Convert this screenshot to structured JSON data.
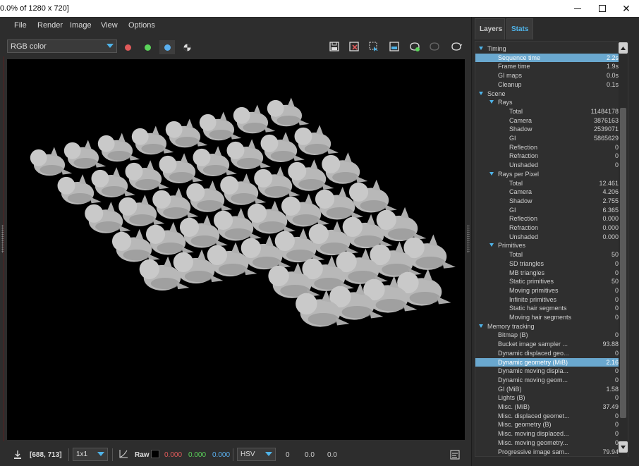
{
  "window": {
    "title": "0.0% of 1280 x 720]"
  },
  "menu": [
    "File",
    "Render",
    "Image",
    "View",
    "Options"
  ],
  "toolbar": {
    "channel_select": "RGB color",
    "channel_colors": [
      "#e05a5a",
      "#5ad35a",
      "#5ab0f0"
    ]
  },
  "tabs": [
    "Layers",
    "Stats"
  ],
  "stats": [
    {
      "label": "Timing",
      "value": "",
      "level": 0,
      "group": true
    },
    {
      "label": "Sequence time",
      "value": "2.2s",
      "level": 1,
      "highlight": true
    },
    {
      "label": "Frame time",
      "value": "1.9s",
      "level": 1
    },
    {
      "label": "GI maps",
      "value": "0.0s",
      "level": 1
    },
    {
      "label": "Cleanup",
      "value": "0.1s",
      "level": 1
    },
    {
      "label": "Scene",
      "value": "",
      "level": 0,
      "group": true
    },
    {
      "label": "Rays",
      "value": "",
      "level": 1,
      "group": true
    },
    {
      "label": "Total",
      "value": "11484178",
      "level": 2
    },
    {
      "label": "Camera",
      "value": "3876163",
      "level": 2
    },
    {
      "label": "Shadow",
      "value": "2539071",
      "level": 2
    },
    {
      "label": "GI",
      "value": "5865629",
      "level": 2
    },
    {
      "label": "Reflection",
      "value": "0",
      "level": 2
    },
    {
      "label": "Refraction",
      "value": "0",
      "level": 2
    },
    {
      "label": "Unshaded",
      "value": "0",
      "level": 2
    },
    {
      "label": "Rays per Pixel",
      "value": "",
      "level": 1,
      "group": true
    },
    {
      "label": "Total",
      "value": "12.461",
      "level": 2
    },
    {
      "label": "Camera",
      "value": "4.206",
      "level": 2
    },
    {
      "label": "Shadow",
      "value": "2.755",
      "level": 2
    },
    {
      "label": "GI",
      "value": "6.365",
      "level": 2
    },
    {
      "label": "Reflection",
      "value": "0.000",
      "level": 2
    },
    {
      "label": "Refraction",
      "value": "0.000",
      "level": 2
    },
    {
      "label": "Unshaded",
      "value": "0.000",
      "level": 2
    },
    {
      "label": "Primitives",
      "value": "",
      "level": 1,
      "group": true
    },
    {
      "label": "Total",
      "value": "50",
      "level": 2
    },
    {
      "label": "SD triangles",
      "value": "0",
      "level": 2
    },
    {
      "label": "MB triangles",
      "value": "0",
      "level": 2
    },
    {
      "label": "Static primitives",
      "value": "50",
      "level": 2
    },
    {
      "label": "Moving primitives",
      "value": "0",
      "level": 2
    },
    {
      "label": "Infinite primitives",
      "value": "0",
      "level": 2
    },
    {
      "label": "Static hair segments",
      "value": "0",
      "level": 2
    },
    {
      "label": "Moving hair segments",
      "value": "0",
      "level": 2
    },
    {
      "label": "Memory tracking",
      "value": "",
      "level": 0,
      "group": true
    },
    {
      "label": "Bitmap (B)",
      "value": "0",
      "level": 1
    },
    {
      "label": "Bucket image sampler ...",
      "value": "93.88",
      "level": 1
    },
    {
      "label": "Dynamic displaced geo...",
      "value": "0",
      "level": 1
    },
    {
      "label": "Dynamic geometry (MiB)",
      "value": "2.16",
      "level": 1,
      "highlight": true
    },
    {
      "label": "Dynamic moving displa...",
      "value": "0",
      "level": 1
    },
    {
      "label": "Dynamic moving geom...",
      "value": "0",
      "level": 1
    },
    {
      "label": "GI (MiB)",
      "value": "1.58",
      "level": 1
    },
    {
      "label": "Lights (B)",
      "value": "0",
      "level": 1
    },
    {
      "label": "Misc. (MiB)",
      "value": "37.49",
      "level": 1
    },
    {
      "label": "Misc. displaced geomet...",
      "value": "0",
      "level": 1
    },
    {
      "label": "Misc. geometry (B)",
      "value": "0",
      "level": 1
    },
    {
      "label": "Misc. moving displaced...",
      "value": "0",
      "level": 1
    },
    {
      "label": "Misc. moving geometry...",
      "value": "0",
      "level": 1
    },
    {
      "label": "Progressive image sam...",
      "value": "79.94",
      "level": 1
    }
  ],
  "status": {
    "coords": "[688, 713]",
    "zoom": "1x1",
    "raw_label": "Raw",
    "r": "0.000",
    "g": "0.000",
    "b": "0.000",
    "color_mode": "HSV",
    "h": "0",
    "s": "0.0",
    "v": "0.0"
  }
}
